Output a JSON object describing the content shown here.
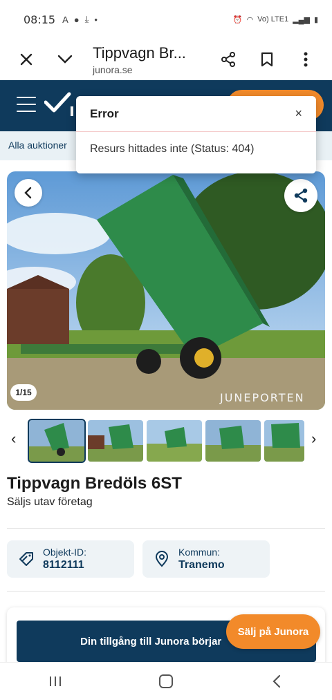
{
  "status_bar": {
    "time": "08:15",
    "network": "Vo) LTE1"
  },
  "browser": {
    "title": "Tippvagn Br...",
    "url": "junora.se"
  },
  "breadcrumb": "Alla auktioner",
  "error": {
    "title": "Error",
    "message": "Resurs hittades inte (Status: 404)",
    "close": "×"
  },
  "gallery": {
    "counter": "1/15",
    "watermark": "JUNEPORTEN"
  },
  "product": {
    "title": "Tippvagn Bredöls 6ST",
    "subtitle": "Säljs utav företag"
  },
  "info": [
    {
      "label": "Objekt-ID:",
      "value": "8112111",
      "icon": "tag-icon"
    },
    {
      "label": "Kommun:",
      "value": "Tranemo",
      "icon": "location-pin-icon"
    }
  ],
  "promo": {
    "text": "Din tillgång till Junora börjar",
    "sell_button": "Sälj på Junora"
  },
  "colors": {
    "brand_navy": "#0f3a5c",
    "accent_orange": "#f28a2a",
    "trailer_green": "#2e8b4a"
  }
}
